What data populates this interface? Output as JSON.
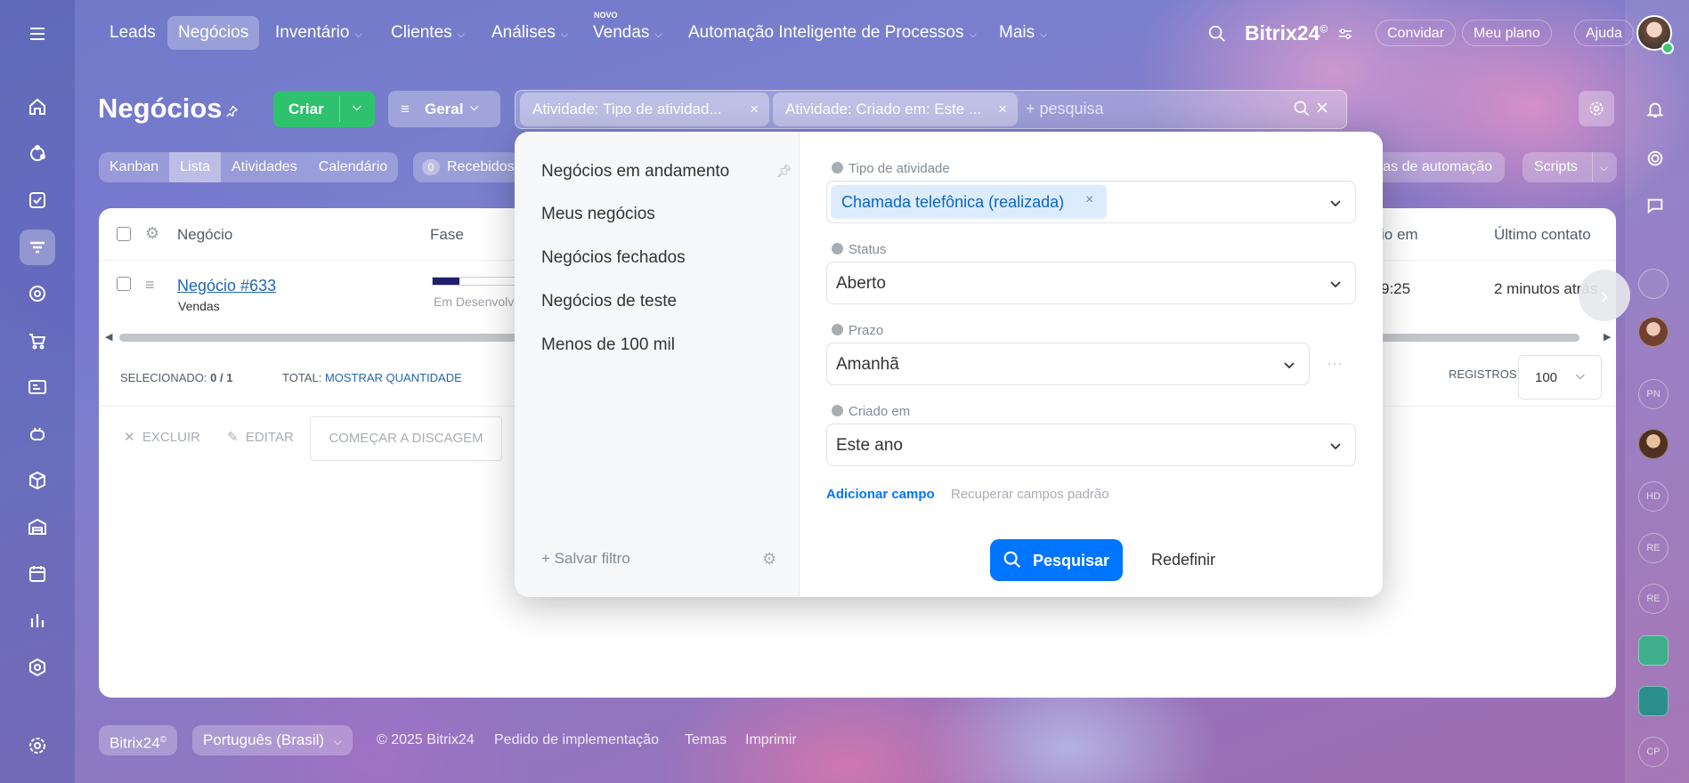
{
  "topnav": {
    "items": [
      "Leads",
      "Negócios",
      "Inventário",
      "Clientes",
      "Análises",
      "Vendas",
      "Automação Inteligente de Processos",
      "Mais"
    ],
    "vendas_badge": "NOVO",
    "brand": "Bitrix24",
    "brand_mark": "©",
    "invite": "Convidar",
    "plan": "Meu plano",
    "help": "Ajuda"
  },
  "header": {
    "title": "Negócios",
    "create_label": "Criar",
    "view_label": "Geral",
    "chips": [
      "Atividade: Tipo de atividad...",
      "Atividade: Criado em: Este ..."
    ],
    "search_placeholder": "+ pesquisa"
  },
  "tabs": [
    "Kanban",
    "Lista",
    "Atividades",
    "Calendário"
  ],
  "received": {
    "count": "0",
    "label": "Recebidos"
  },
  "right_buttons": {
    "automation": "Regras de automação",
    "automation_visible": "gras de automação",
    "scripts": "Scripts"
  },
  "table": {
    "columns": [
      "Negócio",
      "Fase",
      "io em",
      "Último contato"
    ],
    "row": {
      "name": "Negócio #633",
      "pipeline": "Vendas",
      "stage": "Em Desenvolv",
      "time": "9:25",
      "last_contact": "2 minutos atrás"
    }
  },
  "summary": {
    "selected_label": "SELECIONADO:",
    "selected_value": "0 / 1",
    "total_label": "TOTAL:",
    "total_link": "MOSTRAR QUANTIDADE",
    "records_label": "REGISTROS:",
    "records_value": "100"
  },
  "actions": {
    "delete": "EXCLUIR",
    "edit": "EDITAR",
    "dial": "COMEÇAR A DISCAGEM"
  },
  "filter": {
    "presets": [
      "Negócios em andamento",
      "Meus negócios",
      "Negócios fechados",
      "Negócios de teste",
      "Menos de 100 mil"
    ],
    "save": "Salvar filtro",
    "fields": {
      "type_label": "Tipo de atividade",
      "type_value": "Chamada telefônica (realizada)",
      "status_label": "Status",
      "status_value": "Aberto",
      "deadline_label": "Prazo",
      "deadline_value": "Amanhã",
      "created_label": "Criado em",
      "created_value": "Este ano"
    },
    "add_field": "Adicionar campo",
    "restore": "Recuperar campos padrão",
    "search_btn": "Pesquisar",
    "reset_btn": "Redefinir"
  },
  "footer": {
    "brand": "Bitrix24",
    "lang": "Português (Brasil)",
    "copyright": "© 2025 Bitrix24",
    "impl": "Pedido de implementação",
    "themes": "Temas",
    "print": "Imprimir"
  },
  "right_avatars": [
    "PN",
    "HD",
    "RE",
    "RE",
    "CP"
  ],
  "colors": {
    "accent": "#0075ff",
    "green": "#2fc26e",
    "link": "#2067b0"
  }
}
